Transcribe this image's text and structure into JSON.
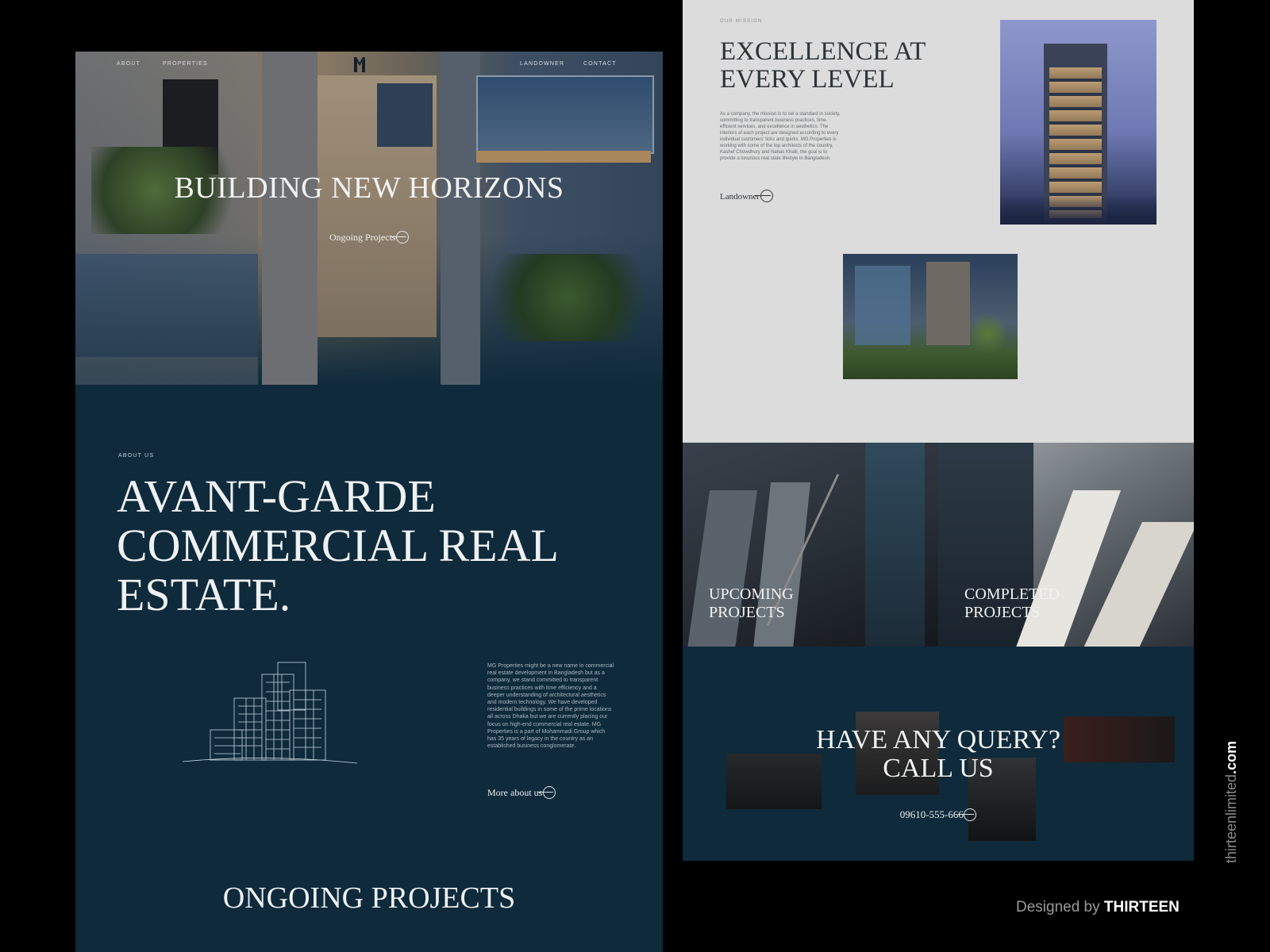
{
  "left": {
    "nav": {
      "about": "ABOUT",
      "properties": "PROPERTIES",
      "landowner": "LANDOWNER",
      "contact": "CONTACT"
    },
    "hero": {
      "title": "BUILDING NEW HORIZONS",
      "cta": "Ongoing Projects"
    },
    "about": {
      "eyebrow": "ABOUT US",
      "headline_line1": "AVANT-GARDE",
      "headline_line2": "COMMERCIAL REAL",
      "headline_line3": "ESTATE.",
      "body": "MG Properties might be a new name in commercial real estate development in Bangladesh but as a company, we stand committed to transparent business practices with time efficiency and a deeper understanding of architectural aesthetics and modern technology. We have developed residential buildings in some of the prime locations all across Dhaka but we are currently placing our focus on high-end commercial real estate. MG Properties is a part of Mohammadi Group which has 35 years of legacy in the country as an established business conglomerate.",
      "cta": "More about us"
    },
    "ongoing_title": "ONGOING PROJECTS"
  },
  "right": {
    "mission": {
      "eyebrow": "OUR MISSION",
      "headline_line1": "EXCELLENCE AT",
      "headline_line2": "EVERY LEVEL",
      "body": "As a company, the mission is to set a standard in society, committing to transparent business practices, time-efficient services, and excellence in aesthetics. The interiors of each project are designed according to every individual customers' ticks and quirks. MG Properties is working with some of the top architects of the country, Kashef Chowdhury and Nahas Khalil, the goal is to provide a luxurious real state lifestyle in Bangladesh.",
      "cta": "Landowner"
    },
    "projects": {
      "upcoming_line1": "UPCOMING",
      "upcoming_line2": "PROJECTS",
      "completed_line1": "COMPLETED",
      "completed_line2": "PROJECTS"
    },
    "contact": {
      "title_line1": "HAVE ANY QUERY?",
      "title_line2": "CALL US",
      "phone": "09610-555-666"
    }
  },
  "credit": {
    "designed_by": "Designed by",
    "studio": "THIRTEEN",
    "vertical_prefix": "thirteenlimited",
    "vertical_suffix": ".com"
  },
  "colors": {
    "navy": "#0e2a3b",
    "mission_bg": "#dcdcdc",
    "text_light": "#e3e6e8"
  }
}
